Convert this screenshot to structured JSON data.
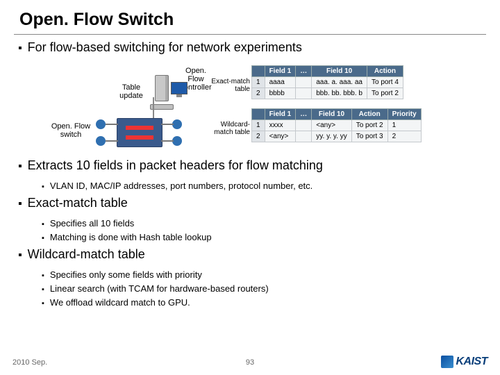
{
  "title": "Open. Flow Switch",
  "lead_bullet": "For flow-based switching for network experiments",
  "diagram": {
    "switch_label": "Open. Flow\nswitch",
    "update_label": "Table\nupdate",
    "controller_label": "Open. Flow\ncontroller",
    "exact_label": "Exact-match\ntable",
    "wild_label": "Wildcard-\nmatch table"
  },
  "tables": {
    "exact": {
      "headers": [
        "",
        "Field 1",
        "…",
        "Field 10",
        "Action"
      ],
      "rows": [
        [
          "1",
          "aaaa",
          "",
          "aaa. a. aaa. aa",
          "To port 4"
        ],
        [
          "2",
          "bbbb",
          "",
          "bbb. bb. bbb. b",
          "To port 2"
        ]
      ]
    },
    "wild": {
      "headers": [
        "",
        "Field 1",
        "…",
        "Field 10",
        "Action",
        "Priority"
      ],
      "rows": [
        [
          "1",
          "xxxx",
          "",
          "<any>",
          "To port 2",
          "1"
        ],
        [
          "2",
          "<any>",
          "",
          "yy. y. y. yy",
          "To port 3",
          "2"
        ]
      ]
    }
  },
  "bullets": [
    {
      "text": "Extracts 10 fields in packet headers for flow matching",
      "sub": [
        "VLAN ID, MAC/IP addresses, port numbers, protocol number, etc."
      ]
    },
    {
      "text": "Exact-match table",
      "sub": [
        "Specifies all 10 fields",
        "Matching is done with Hash table lookup"
      ]
    },
    {
      "text": "Wildcard-match table",
      "sub": [
        "Specifies only some fields with priority",
        "Linear search (with TCAM for hardware-based routers)",
        "We offload wildcard match to GPU."
      ]
    }
  ],
  "footer": {
    "date": "2010 Sep.",
    "page": "93",
    "logo_text": "KAIST"
  }
}
